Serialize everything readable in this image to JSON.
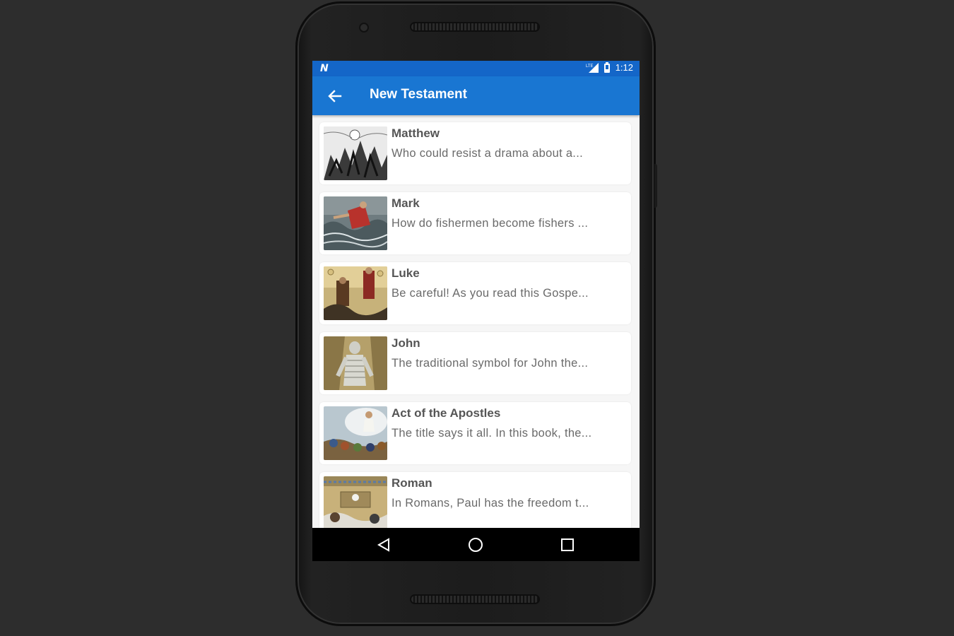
{
  "status_bar": {
    "time": "1:12",
    "network": "LTE",
    "notification_icon": "n-icon"
  },
  "app_bar": {
    "title": "New Testament",
    "back_icon": "arrow-left-icon"
  },
  "books": [
    {
      "title": "Matthew",
      "description": "Who could resist a drama about a..."
    },
    {
      "title": "Mark",
      "description": "How do fishermen become fishers ..."
    },
    {
      "title": "Luke",
      "description": "Be careful!  As you read this Gospe..."
    },
    {
      "title": "John",
      "description": "The traditional symbol for John the..."
    },
    {
      "title": "Act of the Apostles",
      "description": "The title says it all. In this book, the..."
    },
    {
      "title": "Roman",
      "description": "In Romans, Paul has the freedom t..."
    }
  ],
  "nav_bar": {
    "back": "triangle-back-icon",
    "home": "circle-home-icon",
    "recents": "square-recents-icon"
  },
  "colors": {
    "status_bar": "#1466c8",
    "app_bar": "#1976d2",
    "title_text": "#555555",
    "desc_text": "#6a6a6a"
  }
}
